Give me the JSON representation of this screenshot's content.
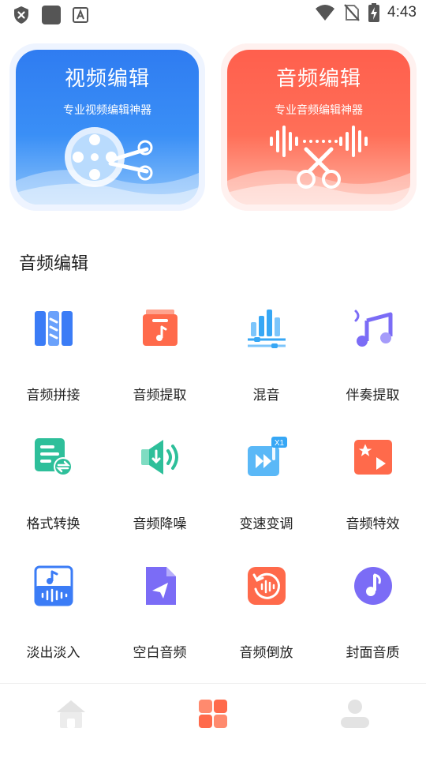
{
  "status_bar": {
    "time": "4:43",
    "left_icons": [
      "shield-x-icon",
      "app-square-icon",
      "font-a-icon"
    ],
    "right_icons": [
      "wifi-icon",
      "no-sim-icon",
      "battery-charging-icon"
    ]
  },
  "hero": {
    "video": {
      "title": "视频编辑",
      "subtitle": "专业视频编辑神器",
      "icon": "film-reel-scissors-icon",
      "color": "#2f7cf1"
    },
    "audio": {
      "title": "音频编辑",
      "subtitle": "专业音频编辑神器",
      "icon": "waveform-scissors-icon",
      "color": "#ff5f4d"
    }
  },
  "section": {
    "title": "音频编辑"
  },
  "tools": [
    {
      "label": "音频拼接",
      "icon": "audio-splice-icon",
      "color": "#3b7cf6"
    },
    {
      "label": "音频提取",
      "icon": "audio-extract-icon",
      "color": "#ff6a4b"
    },
    {
      "label": "混音",
      "icon": "mixer-icon",
      "color": "#37a7f5"
    },
    {
      "label": "伴奏提取",
      "icon": "music-note-icon",
      "color": "#6c5ce7"
    },
    {
      "label": "格式转换",
      "icon": "format-convert-icon",
      "color": "#2ebf9a"
    },
    {
      "label": "音频降噪",
      "icon": "speaker-denoise-icon",
      "color": "#2ebf9a"
    },
    {
      "label": "变速变调",
      "icon": "speed-change-icon",
      "color": "#37a7f5"
    },
    {
      "label": "音频特效",
      "icon": "audio-effect-icon",
      "color": "#ff6a4b"
    },
    {
      "label": "淡出淡入",
      "icon": "fade-in-out-icon",
      "color": "#3b7cf6"
    },
    {
      "label": "空白音频",
      "icon": "blank-audio-icon",
      "color": "#6c5ce7"
    },
    {
      "label": "音频倒放",
      "icon": "audio-reverse-icon",
      "color": "#ff6a4b"
    },
    {
      "label": "封面音质",
      "icon": "cover-quality-icon",
      "color": "#6c5ce7"
    }
  ],
  "bottom_nav": {
    "items": [
      {
        "icon": "home-icon",
        "active": false
      },
      {
        "icon": "grid-icon",
        "active": true
      },
      {
        "icon": "profile-icon",
        "active": false
      }
    ],
    "active_color": "#ff6a4b",
    "inactive_color": "#e3e3e3"
  }
}
